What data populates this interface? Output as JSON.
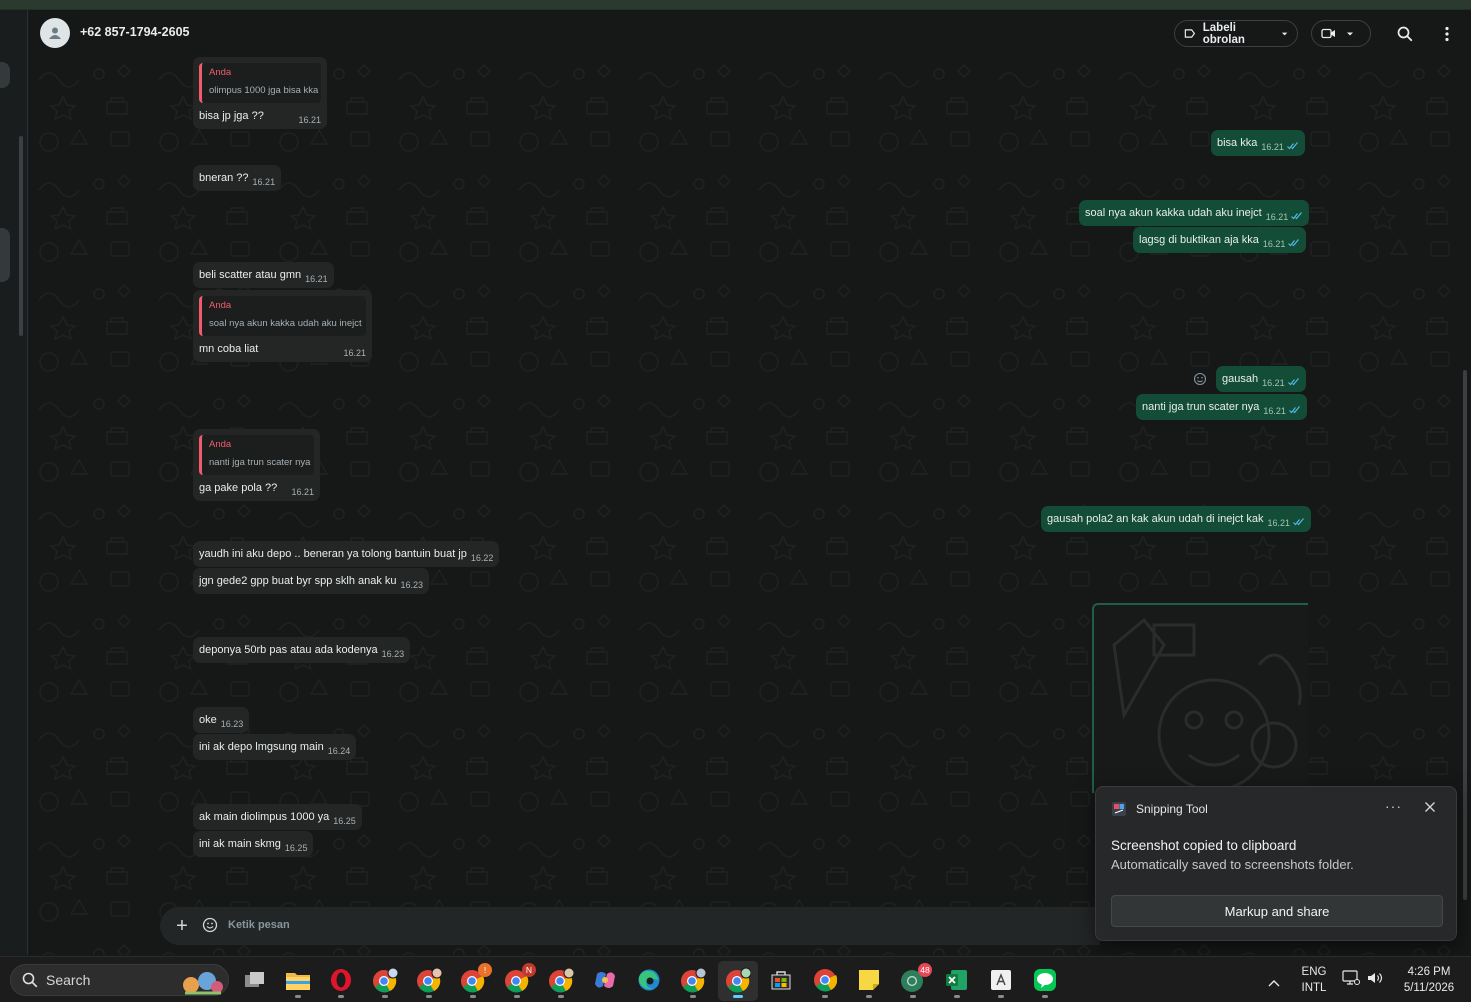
{
  "header": {
    "contact_name": "+62 857-1794-2605",
    "label_button": "Labeli obrolan"
  },
  "messages": [
    {
      "dir": "in",
      "quote_name": "Anda",
      "quote_text": "olimpus 1000 jga bisa kka",
      "text": "bisa jp jga ??",
      "time": "16.21"
    },
    {
      "dir": "out",
      "text": "bisa kka",
      "time": "16.21"
    },
    {
      "dir": "in",
      "text": "bneran ??",
      "time": "16.21"
    },
    {
      "dir": "out",
      "text": "soal nya akun kakka udah aku inejct",
      "time": "16.21"
    },
    {
      "dir": "out",
      "text": "lagsg di buktikan aja kka",
      "time": "16.21"
    },
    {
      "dir": "in",
      "text": "beli scatter atau gmn",
      "time": "16.21"
    },
    {
      "dir": "in",
      "quote_name": "Anda",
      "quote_text": "soal nya akun kakka udah aku inejct",
      "text": "mn coba liat",
      "time": "16.21"
    },
    {
      "dir": "out",
      "text": "gausah",
      "time": "16.21"
    },
    {
      "dir": "out",
      "text": "nanti jga trun scater nya",
      "time": "16.21"
    },
    {
      "dir": "in",
      "quote_name": "Anda",
      "quote_text": "nanti jga trun scater nya",
      "text": "ga pake pola ??",
      "time": "16.21"
    },
    {
      "dir": "out",
      "text": "gausah pola2 an kak akun udah di inejct kak",
      "time": "16.21"
    },
    {
      "dir": "in",
      "text": "yaudh ini aku depo .. beneran ya tolong bantuin buat jp",
      "time": "16.22"
    },
    {
      "dir": "in",
      "text": "jgn gede2 gpp buat byr spp sklh anak ku",
      "time": "16.23"
    },
    {
      "dir": "in",
      "text": "deponya 50rb pas atau ada kodenya",
      "time": "16.23"
    },
    {
      "dir": "in",
      "text": "oke",
      "time": "16.23"
    },
    {
      "dir": "in",
      "text": "ini ak depo lmgsung main",
      "time": "16.24"
    },
    {
      "dir": "in",
      "text": "ak main diolimpus 1000 ya",
      "time": "16.25"
    },
    {
      "dir": "in",
      "text": "ini ak main skmg",
      "time": "16.25"
    }
  ],
  "composer": {
    "placeholder": "Ketik pesan"
  },
  "toast": {
    "app_name": "Snipping Tool",
    "more": "···",
    "title": "Screenshot copied to clipboard",
    "subtitle": "Automatically saved to screenshots folder.",
    "button": "Markup and share"
  },
  "taskbar": {
    "search_label": "Search",
    "badge_count": "48",
    "chrome_badge_1": "!",
    "chrome_badge_2": "N",
    "lang_line1": "ENG",
    "lang_line2": "INTL",
    "time": "4:26 PM",
    "date": "5/11/2026"
  },
  "colors": {
    "accent_out": "#144d37",
    "bubble_in": "#242626",
    "quote_accent": "#f15c6d"
  }
}
